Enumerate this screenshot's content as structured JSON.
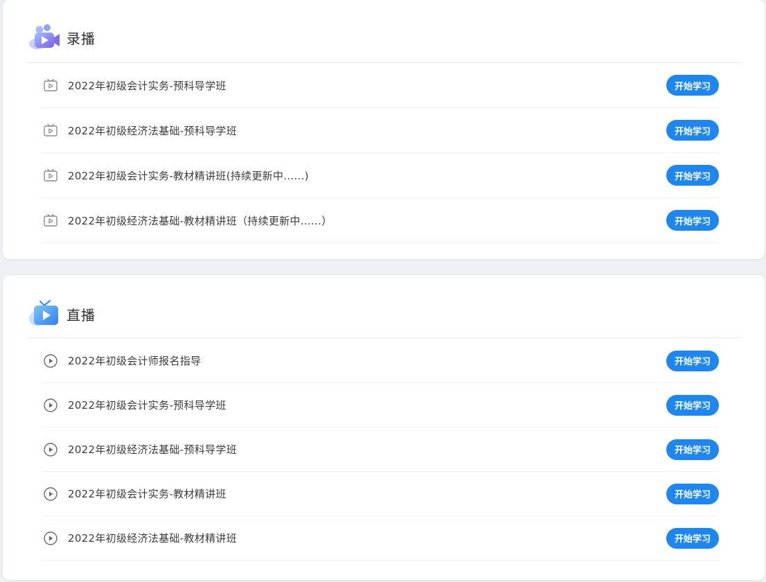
{
  "accent_color": "#1c86f2",
  "recorded": {
    "title": "录播",
    "icon": "video-camera-icon",
    "courses": [
      {
        "title": "2022年初级会计实务-预科导学班",
        "button": "开始学习",
        "icon": "tv-play-icon"
      },
      {
        "title": "2022年初级经济法基础-预科导学班",
        "button": "开始学习",
        "icon": "tv-play-icon"
      },
      {
        "title": "2022年初级会计实务-教材精讲班(持续更新中......)",
        "button": "开始学习",
        "icon": "tv-play-icon"
      },
      {
        "title": "2022年初级经济法基础-教材精讲班（持续更新中......）",
        "button": "开始学习",
        "icon": "tv-play-icon"
      }
    ]
  },
  "live": {
    "title": "直播",
    "icon": "tv-icon",
    "courses": [
      {
        "title": "2022年初级会计师报名指导",
        "button": "开始学习",
        "icon": "play-circle-icon"
      },
      {
        "title": "2022年初级会计实务-预科导学班",
        "button": "开始学习",
        "icon": "play-circle-icon"
      },
      {
        "title": "2022年初级经济法基础-预科导学班",
        "button": "开始学习",
        "icon": "play-circle-icon"
      },
      {
        "title": "2022年初级会计实务-教材精讲班",
        "button": "开始学习",
        "icon": "play-circle-icon"
      },
      {
        "title": "2022年初级经济法基础-教材精讲班",
        "button": "开始学习",
        "icon": "play-circle-icon"
      }
    ]
  }
}
